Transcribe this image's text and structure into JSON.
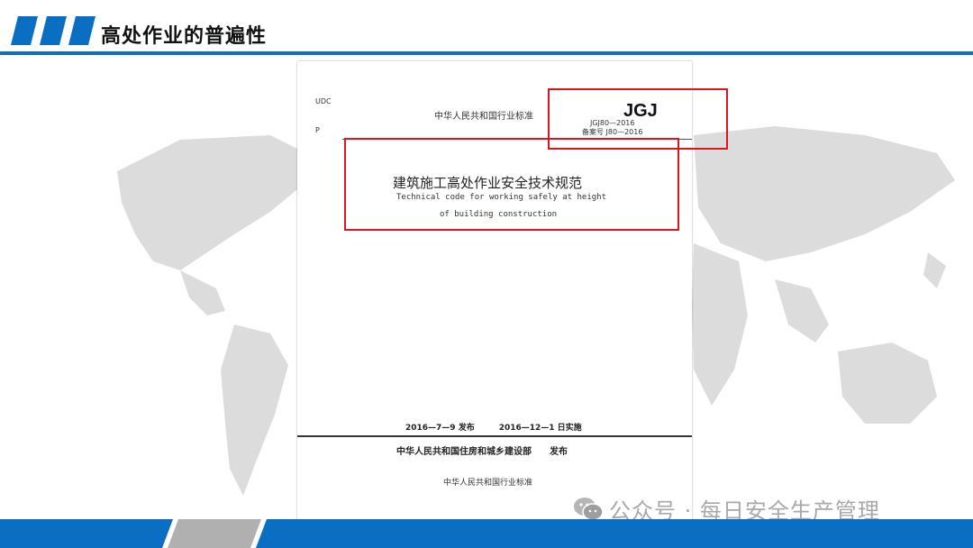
{
  "header": {
    "title": "高处作业的普遍性"
  },
  "document": {
    "udc": "UDC",
    "p": "P",
    "standard_heading": "中华人民共和国行业标准",
    "series": "JGJ",
    "code": "JGJ80—2016",
    "record_number": "备案号 J80—2016",
    "title_cn": "建筑施工高处作业安全技术规范",
    "title_en_line1": "Technical code for working safely at height",
    "title_en_line2": "of building construction",
    "dates": "2016—7—9 发布　　　2016—12—1 日实施",
    "issuer": "中华人民共和国住房和城乡建设部　　发布",
    "footer_standard": "中华人民共和国行业标准"
  },
  "watermark": {
    "text": "公众号 · 每日安全生产管理",
    "icon": "wechat-icon"
  },
  "colors": {
    "accent": "#0a6fc2",
    "highlight": "#e0141d",
    "map": "#dcdcdc"
  }
}
